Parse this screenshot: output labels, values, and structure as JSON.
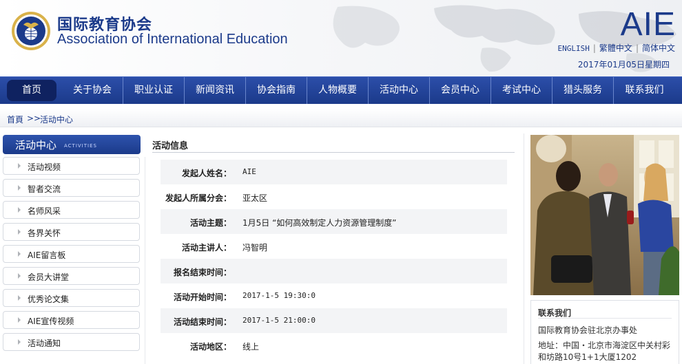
{
  "header": {
    "title_cn": "国际教育协会",
    "title_en": "Association of International Education",
    "brand": "AIE",
    "lang_english": "ENGLISH",
    "lang_traditional": "繁體中文",
    "lang_simplified": "简体中文",
    "separator": "|",
    "date": "2017年01月05日星期四"
  },
  "nav": {
    "items": [
      "首页",
      "关于协会",
      "职业认证",
      "新闻资讯",
      "协会指南",
      "人物概要",
      "活动中心",
      "会员中心",
      "考试中心",
      "猎头服务",
      "联系我们"
    ]
  },
  "breadcrumb": {
    "home": "首頁",
    "sep": ">>",
    "current": "活动中心"
  },
  "sidebar": {
    "title": "活动中心",
    "subtitle": "ACTIVITIES",
    "items": [
      "活动视频",
      "智者交流",
      "名师风采",
      "各界关怀",
      "AIE留言板",
      "会员大讲堂",
      "优秀论文集",
      "AIE宣传视频",
      "活动通知"
    ]
  },
  "main": {
    "title": "活动信息",
    "rows": [
      {
        "label": "发起人姓名：",
        "value": "AIE"
      },
      {
        "label": "发起人所属分会：",
        "value": "亚太区"
      },
      {
        "label": "活动主题：",
        "value": "1月5日 “如何高效制定人力资源管理制度”"
      },
      {
        "label": "活动主讲人：",
        "value": "冯智明"
      },
      {
        "label": "报名结束时间：",
        "value": ""
      },
      {
        "label": "活动开始时间：",
        "value": "2017-1-5 19:30:0"
      },
      {
        "label": "活动结束时间：",
        "value": "2017-1-5 21:00:0"
      },
      {
        "label": "活动地区：",
        "value": "线上"
      }
    ]
  },
  "contact": {
    "title": "联系我们",
    "office": "国际教育协会驻北京办事处",
    "address": "地址：中国・北京市海淀区中关村彩和坊路10号1+1大厦1202"
  },
  "colors": {
    "brand_blue": "#1b3a8a",
    "nav_blue": "#2c4ea9",
    "home_tab": "#0f2260"
  }
}
